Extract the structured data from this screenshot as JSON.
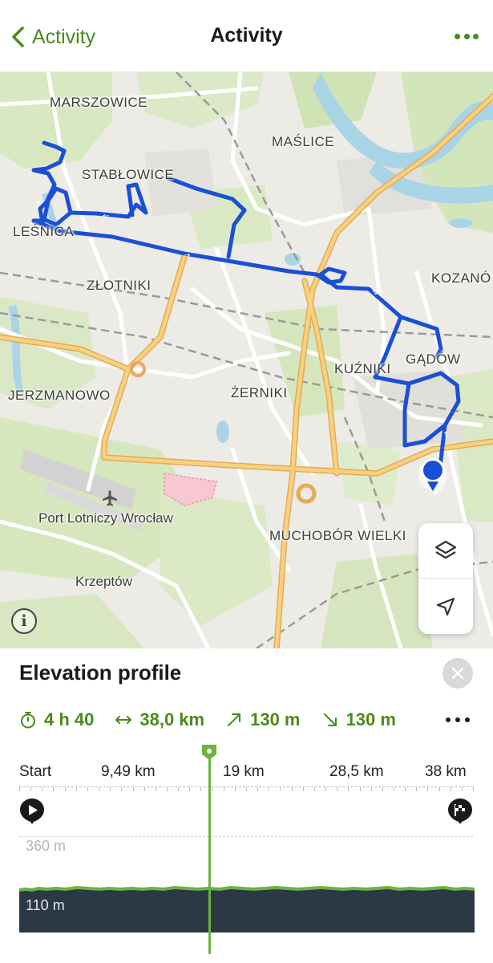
{
  "header": {
    "back_label": "Activity",
    "title": "Activity",
    "back_icon": "chevron-left-icon",
    "more_icon": "more-horizontal-icon"
  },
  "map": {
    "labels": {
      "marszowice": "MARSZOWICE",
      "maslice": "MAŚLICE",
      "stablowice": "STABŁOWICE",
      "lesnica": "LEŚNICA",
      "zlotniki": "ZŁOTNIKI",
      "kozanow": "KOZANÓ",
      "kuzniki": "KUŹNIKI",
      "gadow": "GĄDÓW",
      "jerzmanowo": "JERZMANOWO",
      "zerniki": "ŻERNIKI",
      "airport": "Port Lotniczy Wrocław",
      "muchobor": "MUCHOBÓR WIELKI",
      "krzeptow": "Krzeptów"
    },
    "route_color": "#1a4fd6",
    "controls": {
      "layers_icon": "layers-icon",
      "locate_icon": "navigation-arrow-icon",
      "info_icon": "info-icon"
    }
  },
  "panel": {
    "title": "Elevation profile",
    "close_icon": "close-icon",
    "stats": {
      "duration": "4 h 40",
      "distance": "38,0 km",
      "ascent": "130 m",
      "descent": "130 m"
    },
    "stats_icons": [
      "stopwatch-icon",
      "distance-arrows-icon",
      "ascent-arrow-icon",
      "descent-arrow-icon"
    ],
    "axis": [
      "Start",
      "9,49 km",
      "19 km",
      "28,5 km",
      "38 km"
    ],
    "elevation_max_label": "360 m",
    "elevation_min_label": "110 m",
    "accent_color": "#4a8a1c",
    "cursor_position": 0.42
  }
}
